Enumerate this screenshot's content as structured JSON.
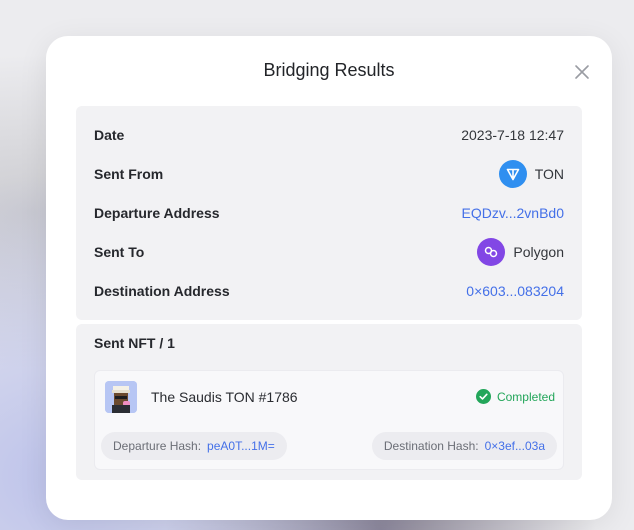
{
  "modal": {
    "title": "Bridging Results"
  },
  "details": {
    "date_label": "Date",
    "date_value": "2023-7-18 12:47",
    "sent_from_label": "Sent From",
    "sent_from_chain": "TON",
    "sent_from_icon": "ton-icon",
    "departure_address_label": "Departure Address",
    "departure_address_value": "EQDzv...2vnBd0",
    "sent_to_label": "Sent To",
    "sent_to_chain": "Polygon",
    "sent_to_icon": "polygon-icon",
    "destination_address_label": "Destination Address",
    "destination_address_value": "0×603...083204"
  },
  "nft": {
    "header": "Sent NFT / 1",
    "name": "The Saudis TON #1786",
    "status": "Completed",
    "departure_hash_label": "Departure Hash:",
    "departure_hash_value": "peA0T...1M=",
    "destination_hash_label": "Destination Hash:",
    "destination_hash_value": "0×3ef...03a"
  },
  "colors": {
    "link": "#4470e8",
    "success": "#23a65a",
    "ton": "#2f8ff0",
    "polygon": "#8247e5"
  }
}
